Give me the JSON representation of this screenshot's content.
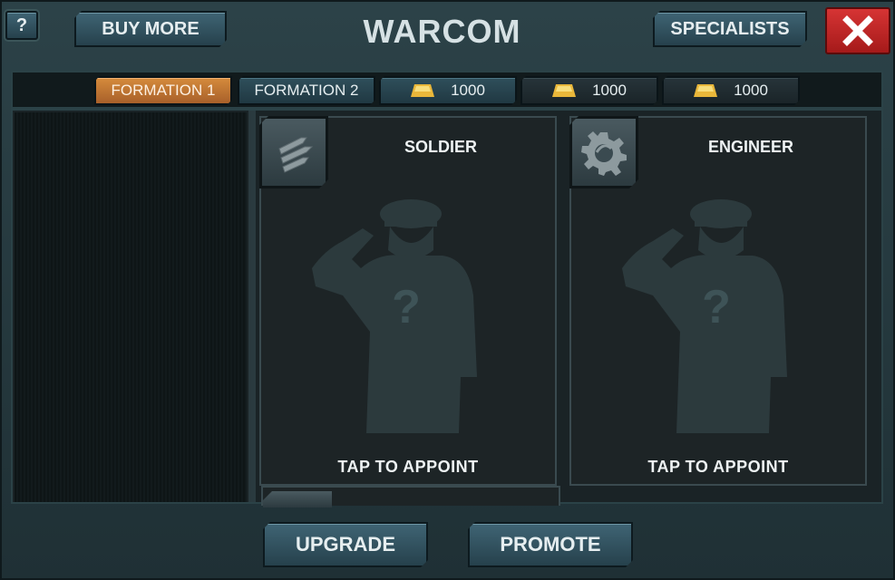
{
  "header": {
    "help_label": "?",
    "buy_more_label": "BUY MORE",
    "title": "WARCOM",
    "specialists_label": "SPECIALISTS",
    "close_icon": "close-icon"
  },
  "tabs": [
    {
      "label": "FORMATION 1",
      "active": true
    },
    {
      "label": "FORMATION 2",
      "active": false
    },
    {
      "label": "1000",
      "icon": "gold-bar-icon",
      "locked": false
    },
    {
      "label": "1000",
      "icon": "gold-bar-icon",
      "locked": true
    },
    {
      "label": "1000",
      "icon": "gold-bar-icon",
      "locked": true
    }
  ],
  "cards": [
    {
      "title": "SOLDIER",
      "icon": "bullets-icon",
      "action": "TAP TO APPOINT"
    },
    {
      "title": "ENGINEER",
      "icon": "gear-icon",
      "action": "TAP TO APPOINT"
    }
  ],
  "footer": {
    "upgrade_label": "UPGRADE",
    "promote_label": "PROMOTE"
  },
  "colors": {
    "accent_orange": "#c97a32",
    "button_blue": "#3f6474",
    "close_red": "#d63434"
  }
}
